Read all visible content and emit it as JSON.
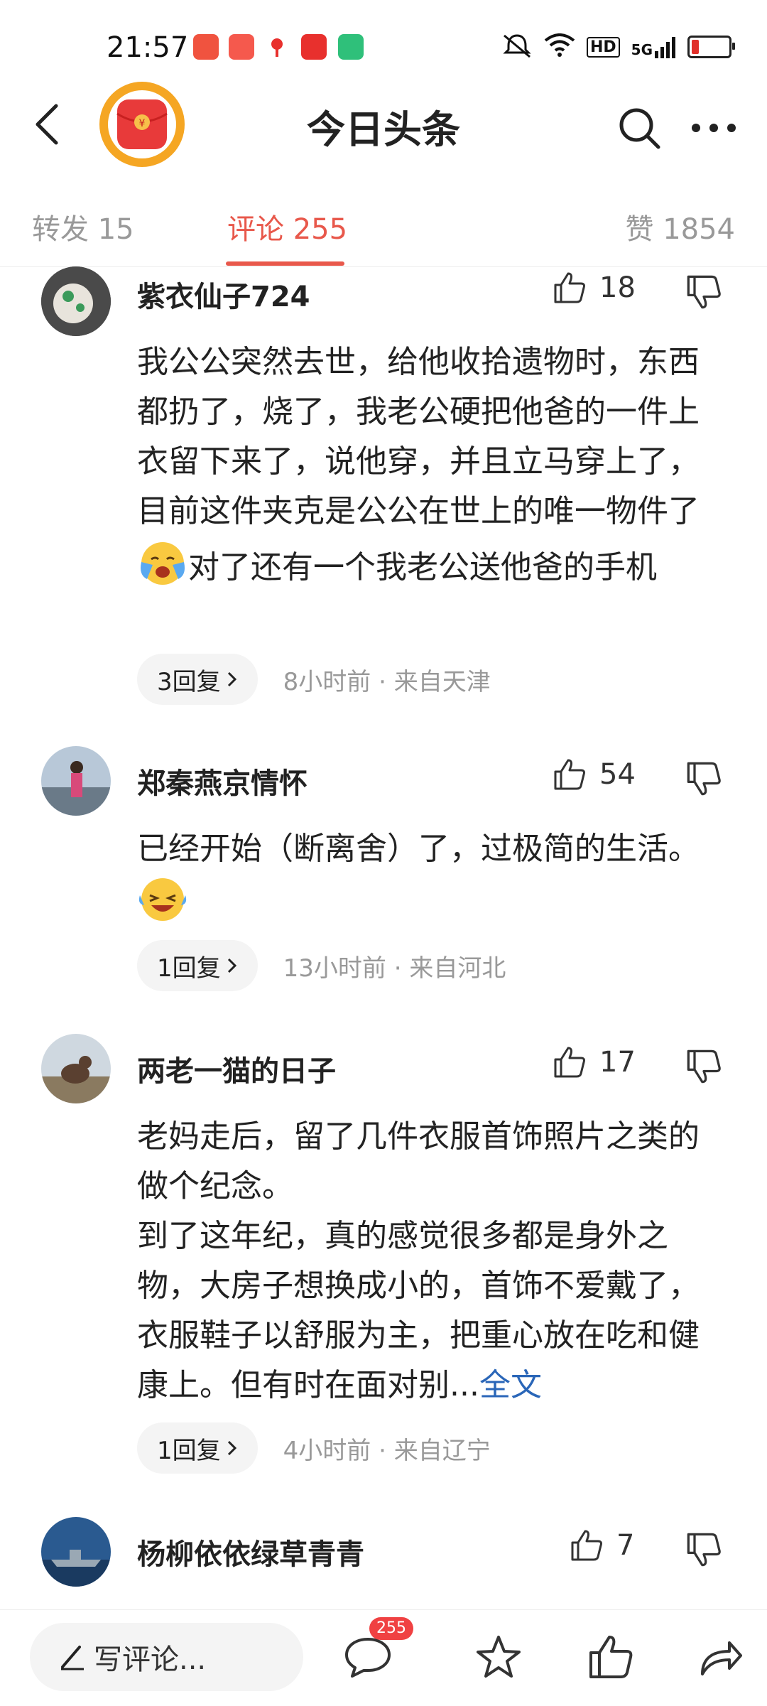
{
  "status_bar": {
    "time": "21:57",
    "hd": "HD",
    "network": "5G",
    "notification_colors": [
      "#f0533f",
      "#f5594d",
      "#ffffff",
      "#e8302d",
      "#2fc07a"
    ]
  },
  "header": {
    "title": "今日头条",
    "logo_icon": "red-envelope-icon"
  },
  "tabs": [
    {
      "label": "转发 15",
      "active": false
    },
    {
      "label": "评论 255",
      "active": true
    },
    {
      "label": "赞 1854",
      "active": false
    }
  ],
  "comments": [
    {
      "username": "紫衣仙子724",
      "likes": "18",
      "text_a": "我公公突然去世，给他收拾遗物时，东西都扔了，烧了，我老公硬把他爸的一件上衣留下来了，说他穿，并且立马穿上了，目前这件夹克是公公在世上的唯一物件了",
      "text_b": "对了还有一个我老公送他爸的手机",
      "replies": "3回复",
      "meta": "8小时前 · 来自天津"
    },
    {
      "username": "郑秦燕京情怀",
      "likes": "54",
      "text_a": "已经开始（断离舍）了，过极简的生活。",
      "replies": "1回复",
      "meta": "13小时前 · 来自河北"
    },
    {
      "username": "两老一猫的日子",
      "likes": "17",
      "text_a": "老妈走后，留了几件衣服首饰照片之类的做个纪念。",
      "text_b": "到了这年纪，真的感觉很多都是身外之物，大房子想换成小的，首饰不爱戴了，衣服鞋子以舒服为主，把重心放在吃和健康上。但有时在面对别...",
      "more_label": "全文",
      "replies": "1回复",
      "meta": "4小时前 · 来自辽宁"
    },
    {
      "username": "杨柳依依绿草青青",
      "likes": "7"
    }
  ],
  "bottom_bar": {
    "write_placeholder": "写评论...",
    "comment_count": "255"
  }
}
